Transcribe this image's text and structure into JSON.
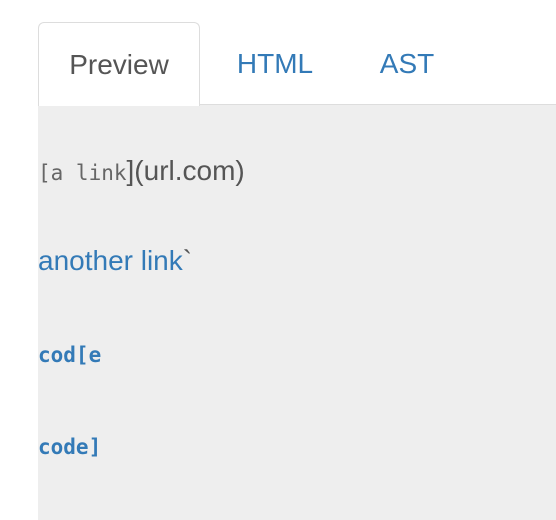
{
  "tabs": [
    {
      "label": "Preview",
      "active": true
    },
    {
      "label": "HTML",
      "active": false
    },
    {
      "label": "AST",
      "active": false
    }
  ],
  "preview": {
    "line1": {
      "code": "[a link",
      "text": "](url.com)"
    },
    "line2": {
      "link": "another link",
      "tail": "`"
    },
    "line3": {
      "link": "cod[e"
    },
    "line4": {
      "link": "code]"
    }
  },
  "colors": {
    "link": "#337ab7",
    "text": "#555555",
    "preview_bg": "#eeeeee",
    "border": "#dddddd"
  }
}
